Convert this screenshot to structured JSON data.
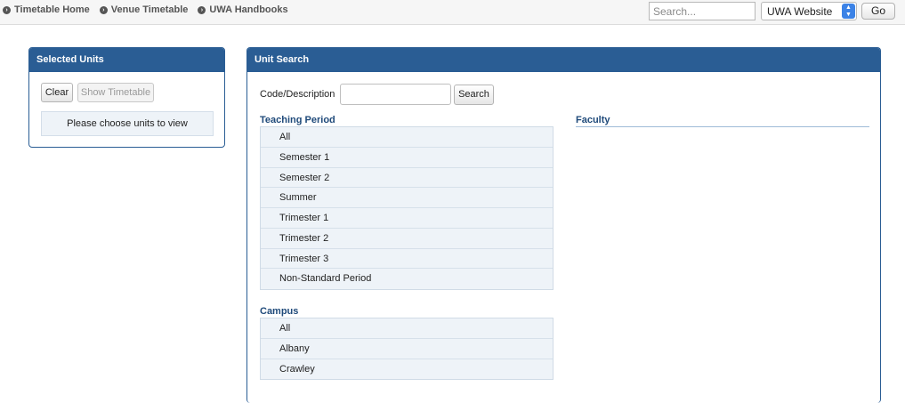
{
  "topbar": {
    "links": [
      "Timetable Home",
      "Venue Timetable",
      "UWA Handbooks"
    ],
    "search_placeholder": "Search...",
    "site_select_value": "UWA Website",
    "go_label": "Go"
  },
  "selected_units": {
    "title": "Selected Units",
    "clear_label": "Clear",
    "show_timetable_label": "Show Timetable",
    "message": "Please choose units to view"
  },
  "unit_search": {
    "title": "Unit Search",
    "code_label": "Code/Description",
    "code_value": "",
    "search_label": "Search",
    "teaching_period": {
      "title": "Teaching Period",
      "items": [
        "All",
        "Semester 1",
        "Semester 2",
        "Summer",
        "Trimester 1",
        "Trimester 2",
        "Trimester 3",
        "Non-Standard Period"
      ]
    },
    "faculty": {
      "title": "Faculty"
    },
    "campus": {
      "title": "Campus",
      "items": [
        "All",
        "Albany",
        "Crawley"
      ]
    }
  }
}
